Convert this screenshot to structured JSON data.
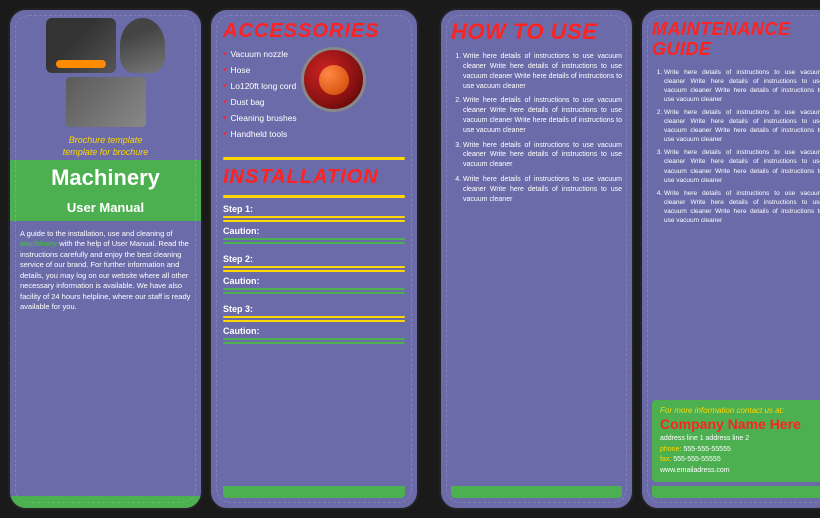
{
  "left_panel": {
    "tagline_line1": "Brochure template",
    "tagline_line2": "template for brochure",
    "main_title": "Machinery",
    "subtitle": "User Manual",
    "body_text": "A guide to the installation, use and cleaning of ",
    "body_bold": "Machinery",
    "body_text2": " with the help of User Manual. Read the instructions carefully and enjoy the best cleaning service of our brand. For further information and details, you may log on our website where all other necessary information is available. We have also facility of 24 hours helpline, where our staff is ready available for you."
  },
  "middle_panel": {
    "accessories_title": "ACCESSORIES",
    "accessories": [
      "Vacuum nozzle",
      "Hose",
      "Lo120ft long cord",
      "Dust bag",
      "Cleaning brushes",
      "Handheld tools"
    ],
    "installation_title": "INSTALLATION",
    "steps": [
      {
        "label": "Step 1:",
        "caution": "Caution:"
      },
      {
        "label": "Step 2:",
        "caution": "Caution:"
      },
      {
        "label": "Step 3:",
        "caution": "Caution:"
      }
    ]
  },
  "howto_panel": {
    "title": "HOW TO USE",
    "items": [
      "Write here details of instructions to use vacuum cleaner Write here details of instructions to use vacuum cleaner Write here details of instructions to use vacuum cleaner",
      "Write here details of instructions to use vacuum cleaner Write here details of instructions to use vacuum cleaner Write here details of instructions to use vacuum cleaner",
      "Write here details of instructions to use vacuum cleaner Write here details of instructions to use vacuum cleaner",
      "Write here details of instructions to use vacuum cleaner Write here details of instructions to use vacuum cleaner"
    ]
  },
  "maintenance_panel": {
    "title": "MAINTENANCE GUIDE",
    "items": [
      "Write here details of instructions to use vacuum cleaner Write here details of instructions to use vacuum cleaner Write here details of instructions to use vacuum cleaner",
      "Write here details of instructions to use vacuum cleaner Write here details of instructions to use vacuum cleaner Write here details of instructions to use vacuum cleaner",
      "Write here details of instructions to use vacuum cleaner Write here details of instructions to use vacuum cleaner Write here details of instructions to use vacuum cleaner",
      "Write here details of instructions to use vacuum cleaner Write here details of instructions to use vacuum cleaner Write here details of instructions to use vacuum cleaner"
    ],
    "contact_prompt": "For more information contact us at:",
    "company_name": "Company Name Here",
    "address_line1": "address line 1 address line 2",
    "phone_label": "phone:",
    "phone": "555-555-55555",
    "fax_label": "fax:",
    "fax": "555-555-55555",
    "website": "www.emailadress.com"
  }
}
